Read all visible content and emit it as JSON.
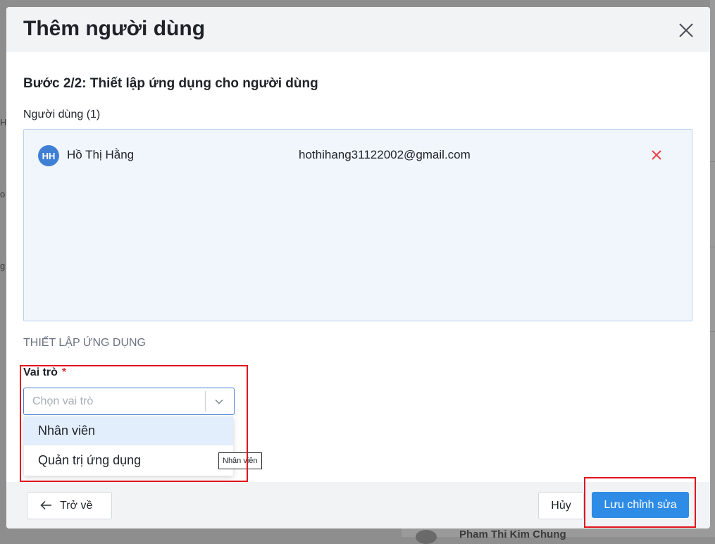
{
  "dialog": {
    "title": "Thêm người dùng",
    "step_title": "Bước 2/2: Thiết lập ứng dụng cho người dùng"
  },
  "users": {
    "label": "Người dùng (1)",
    "items": [
      {
        "initials": "HH",
        "name": "Hồ Thị Hằng",
        "email": "hothihang31122002@gmail.com"
      }
    ]
  },
  "app_setup": {
    "heading": "THIẾT LẬP ỨNG DỤNG",
    "role_label": "Vai trò",
    "required_mark": "*",
    "role_placeholder": "Chọn vai trò",
    "role_options": [
      "Nhân viên",
      "Quản trị ứng dụng"
    ],
    "tooltip": "Nhân viên"
  },
  "footer": {
    "back_label": "Trở về",
    "cancel_label": "Hủy",
    "save_label": "Lưu chỉnh sửa"
  },
  "background": {
    "bottom_row_name": "Pham Thi Kim Chung",
    "right_fragment": "Nhân vi"
  },
  "colors": {
    "primary": "#2e8ce6",
    "avatar": "#3f7fd4",
    "remove": "#e8494f",
    "highlight": "#e0141e"
  }
}
